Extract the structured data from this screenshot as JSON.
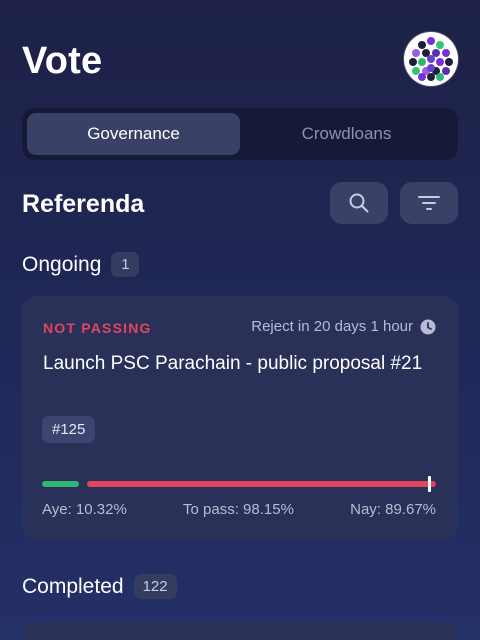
{
  "header": {
    "title": "Vote"
  },
  "tabs": [
    {
      "label": "Governance",
      "active": true
    },
    {
      "label": "Crowdloans",
      "active": false
    }
  ],
  "section": {
    "title": "Referenda"
  },
  "ongoing": {
    "title": "Ongoing",
    "count": "1",
    "referendum": {
      "status": "NOT PASSING",
      "time_left": "Reject in 20 days 1 hour",
      "title": "Launch PSC Parachain - public proposal #21",
      "id": "#125",
      "aye_label": "Aye: 10.32%",
      "to_pass_label": "To pass: 98.15%",
      "nay_label": "Nay: 89.67%",
      "aye_percent": 10.32,
      "threshold_percent": 98.15,
      "nay_percent": 89.67
    }
  },
  "completed": {
    "title": "Completed",
    "count": "122"
  },
  "colors": {
    "accent_nay": "#e0455f",
    "accent_aye": "#2fb875",
    "card_bg": "#2a3158",
    "button_bg": "#3a4167"
  },
  "icons": {
    "search": "search-icon",
    "filter": "filter-icon",
    "clock": "clock-icon",
    "avatar": "identicon-avatar"
  }
}
